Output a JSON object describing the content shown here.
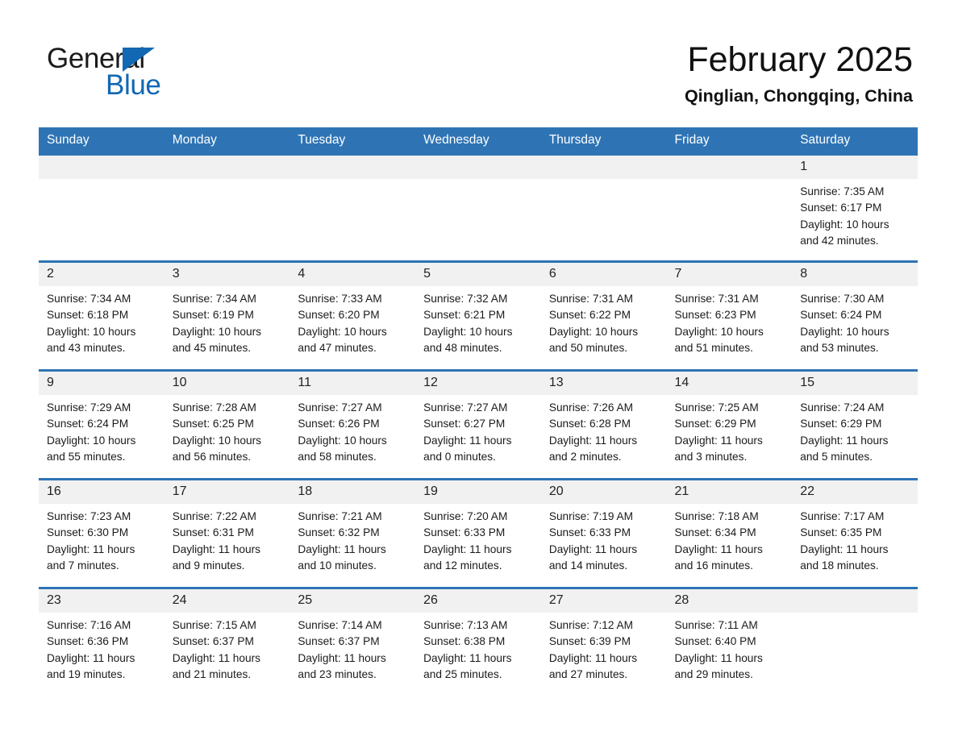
{
  "brand": {
    "name_part1": "General",
    "name_part2": "Blue",
    "triangle_color": "#1268b3"
  },
  "header": {
    "month_title": "February 2025",
    "location": "Qinglian, Chongqing, China"
  },
  "theme": {
    "header_blue": "#2e74b5",
    "daynum_band": "#f1f1f1",
    "text": "#1b1b1b"
  },
  "calendar": {
    "weekday_headers": [
      "Sunday",
      "Monday",
      "Tuesday",
      "Wednesday",
      "Thursday",
      "Friday",
      "Saturday"
    ],
    "weeks": [
      [
        {
          "day": "",
          "sunrise": "",
          "sunset": "",
          "daylight": "",
          "daylight2": ""
        },
        {
          "day": "",
          "sunrise": "",
          "sunset": "",
          "daylight": "",
          "daylight2": ""
        },
        {
          "day": "",
          "sunrise": "",
          "sunset": "",
          "daylight": "",
          "daylight2": ""
        },
        {
          "day": "",
          "sunrise": "",
          "sunset": "",
          "daylight": "",
          "daylight2": ""
        },
        {
          "day": "",
          "sunrise": "",
          "sunset": "",
          "daylight": "",
          "daylight2": ""
        },
        {
          "day": "",
          "sunrise": "",
          "sunset": "",
          "daylight": "",
          "daylight2": ""
        },
        {
          "day": "1",
          "sunrise": "Sunrise: 7:35 AM",
          "sunset": "Sunset: 6:17 PM",
          "daylight": "Daylight: 10 hours",
          "daylight2": "and 42 minutes."
        }
      ],
      [
        {
          "day": "2",
          "sunrise": "Sunrise: 7:34 AM",
          "sunset": "Sunset: 6:18 PM",
          "daylight": "Daylight: 10 hours",
          "daylight2": "and 43 minutes."
        },
        {
          "day": "3",
          "sunrise": "Sunrise: 7:34 AM",
          "sunset": "Sunset: 6:19 PM",
          "daylight": "Daylight: 10 hours",
          "daylight2": "and 45 minutes."
        },
        {
          "day": "4",
          "sunrise": "Sunrise: 7:33 AM",
          "sunset": "Sunset: 6:20 PM",
          "daylight": "Daylight: 10 hours",
          "daylight2": "and 47 minutes."
        },
        {
          "day": "5",
          "sunrise": "Sunrise: 7:32 AM",
          "sunset": "Sunset: 6:21 PM",
          "daylight": "Daylight: 10 hours",
          "daylight2": "and 48 minutes."
        },
        {
          "day": "6",
          "sunrise": "Sunrise: 7:31 AM",
          "sunset": "Sunset: 6:22 PM",
          "daylight": "Daylight: 10 hours",
          "daylight2": "and 50 minutes."
        },
        {
          "day": "7",
          "sunrise": "Sunrise: 7:31 AM",
          "sunset": "Sunset: 6:23 PM",
          "daylight": "Daylight: 10 hours",
          "daylight2": "and 51 minutes."
        },
        {
          "day": "8",
          "sunrise": "Sunrise: 7:30 AM",
          "sunset": "Sunset: 6:24 PM",
          "daylight": "Daylight: 10 hours",
          "daylight2": "and 53 minutes."
        }
      ],
      [
        {
          "day": "9",
          "sunrise": "Sunrise: 7:29 AM",
          "sunset": "Sunset: 6:24 PM",
          "daylight": "Daylight: 10 hours",
          "daylight2": "and 55 minutes."
        },
        {
          "day": "10",
          "sunrise": "Sunrise: 7:28 AM",
          "sunset": "Sunset: 6:25 PM",
          "daylight": "Daylight: 10 hours",
          "daylight2": "and 56 minutes."
        },
        {
          "day": "11",
          "sunrise": "Sunrise: 7:27 AM",
          "sunset": "Sunset: 6:26 PM",
          "daylight": "Daylight: 10 hours",
          "daylight2": "and 58 minutes."
        },
        {
          "day": "12",
          "sunrise": "Sunrise: 7:27 AM",
          "sunset": "Sunset: 6:27 PM",
          "daylight": "Daylight: 11 hours",
          "daylight2": "and 0 minutes."
        },
        {
          "day": "13",
          "sunrise": "Sunrise: 7:26 AM",
          "sunset": "Sunset: 6:28 PM",
          "daylight": "Daylight: 11 hours",
          "daylight2": "and 2 minutes."
        },
        {
          "day": "14",
          "sunrise": "Sunrise: 7:25 AM",
          "sunset": "Sunset: 6:29 PM",
          "daylight": "Daylight: 11 hours",
          "daylight2": "and 3 minutes."
        },
        {
          "day": "15",
          "sunrise": "Sunrise: 7:24 AM",
          "sunset": "Sunset: 6:29 PM",
          "daylight": "Daylight: 11 hours",
          "daylight2": "and 5 minutes."
        }
      ],
      [
        {
          "day": "16",
          "sunrise": "Sunrise: 7:23 AM",
          "sunset": "Sunset: 6:30 PM",
          "daylight": "Daylight: 11 hours",
          "daylight2": "and 7 minutes."
        },
        {
          "day": "17",
          "sunrise": "Sunrise: 7:22 AM",
          "sunset": "Sunset: 6:31 PM",
          "daylight": "Daylight: 11 hours",
          "daylight2": "and 9 minutes."
        },
        {
          "day": "18",
          "sunrise": "Sunrise: 7:21 AM",
          "sunset": "Sunset: 6:32 PM",
          "daylight": "Daylight: 11 hours",
          "daylight2": "and 10 minutes."
        },
        {
          "day": "19",
          "sunrise": "Sunrise: 7:20 AM",
          "sunset": "Sunset: 6:33 PM",
          "daylight": "Daylight: 11 hours",
          "daylight2": "and 12 minutes."
        },
        {
          "day": "20",
          "sunrise": "Sunrise: 7:19 AM",
          "sunset": "Sunset: 6:33 PM",
          "daylight": "Daylight: 11 hours",
          "daylight2": "and 14 minutes."
        },
        {
          "day": "21",
          "sunrise": "Sunrise: 7:18 AM",
          "sunset": "Sunset: 6:34 PM",
          "daylight": "Daylight: 11 hours",
          "daylight2": "and 16 minutes."
        },
        {
          "day": "22",
          "sunrise": "Sunrise: 7:17 AM",
          "sunset": "Sunset: 6:35 PM",
          "daylight": "Daylight: 11 hours",
          "daylight2": "and 18 minutes."
        }
      ],
      [
        {
          "day": "23",
          "sunrise": "Sunrise: 7:16 AM",
          "sunset": "Sunset: 6:36 PM",
          "daylight": "Daylight: 11 hours",
          "daylight2": "and 19 minutes."
        },
        {
          "day": "24",
          "sunrise": "Sunrise: 7:15 AM",
          "sunset": "Sunset: 6:37 PM",
          "daylight": "Daylight: 11 hours",
          "daylight2": "and 21 minutes."
        },
        {
          "day": "25",
          "sunrise": "Sunrise: 7:14 AM",
          "sunset": "Sunset: 6:37 PM",
          "daylight": "Daylight: 11 hours",
          "daylight2": "and 23 minutes."
        },
        {
          "day": "26",
          "sunrise": "Sunrise: 7:13 AM",
          "sunset": "Sunset: 6:38 PM",
          "daylight": "Daylight: 11 hours",
          "daylight2": "and 25 minutes."
        },
        {
          "day": "27",
          "sunrise": "Sunrise: 7:12 AM",
          "sunset": "Sunset: 6:39 PM",
          "daylight": "Daylight: 11 hours",
          "daylight2": "and 27 minutes."
        },
        {
          "day": "28",
          "sunrise": "Sunrise: 7:11 AM",
          "sunset": "Sunset: 6:40 PM",
          "daylight": "Daylight: 11 hours",
          "daylight2": "and 29 minutes."
        },
        {
          "day": "",
          "sunrise": "",
          "sunset": "",
          "daylight": "",
          "daylight2": ""
        }
      ]
    ]
  }
}
